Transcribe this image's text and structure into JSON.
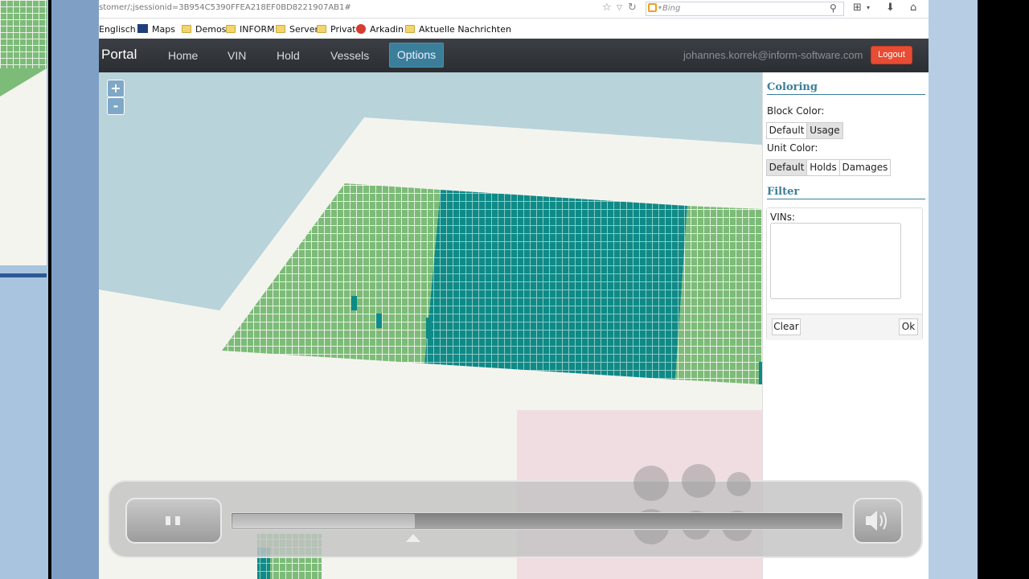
{
  "browser": {
    "url": "stomer/;jsessionid=3B954C5390FFEA218EF0BD8221907AB1#",
    "search_engine": "Bing",
    "bookmarks": [
      "Englisch",
      "Maps",
      "Demos",
      "INFORM",
      "Server",
      "Privat",
      "Arkadin",
      "Aktuelle Nachrichten"
    ]
  },
  "app": {
    "brand": "Portal",
    "nav": [
      "Home",
      "VIN",
      "Hold",
      "Vessels",
      "Options"
    ],
    "active_nav": "Options",
    "user_email": "johannes.korrek@inform-software.com",
    "logout_label": "Logout"
  },
  "map": {
    "zoom_in": "+",
    "zoom_out": "-"
  },
  "sidebar": {
    "coloring_title": "Coloring",
    "block_color_label": "Block Color:",
    "block_color_options": [
      "Default",
      "Usage"
    ],
    "block_color_selected": "Usage",
    "unit_color_label": "Unit Color:",
    "unit_color_options": [
      "Default",
      "Holds",
      "Damages"
    ],
    "unit_color_selected": "Default",
    "filter_title": "Filter",
    "vins_label": "VINs:",
    "vins_value": "",
    "clear_label": "Clear",
    "ok_label": "Ok"
  },
  "player": {
    "progress": 0.3
  },
  "colors": {
    "navbar": "#2f3237",
    "active_nav": "#3a7e9a",
    "logout": "#e84c32",
    "water": "#b8d3da",
    "land": "#f4f4ef",
    "block_default": "#7cbb78",
    "block_usage": "#0e8a87",
    "section_title": "#3a7e9a"
  }
}
